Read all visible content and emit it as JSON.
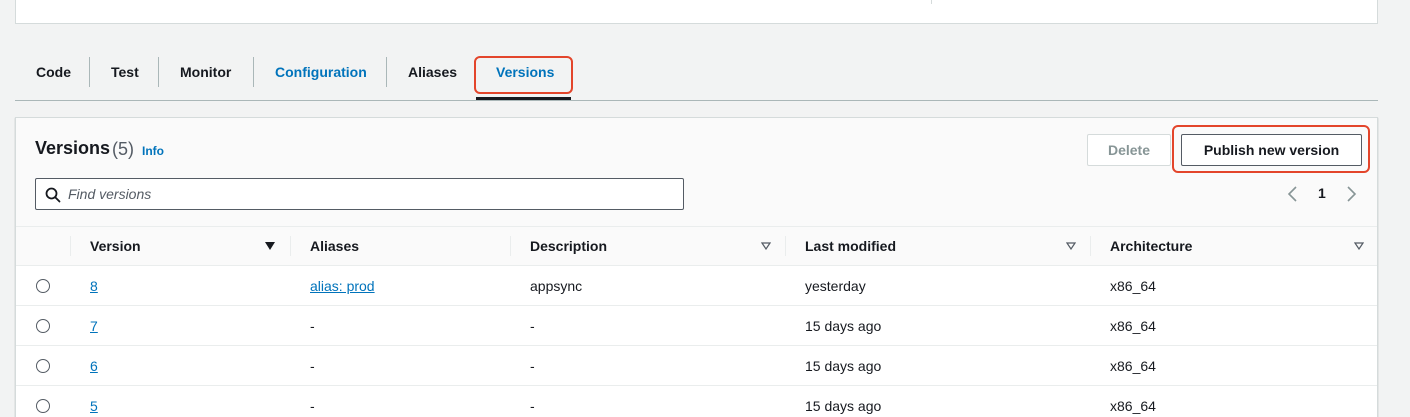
{
  "tabs": [
    {
      "label": "Code"
    },
    {
      "label": "Test"
    },
    {
      "label": "Monitor"
    },
    {
      "label": "Configuration"
    },
    {
      "label": "Aliases"
    },
    {
      "label": "Versions"
    }
  ],
  "active_tab": "Versions",
  "panel": {
    "title": "Versions",
    "count": "(5)",
    "info_label": "Info",
    "delete_label": "Delete",
    "publish_label": "Publish new version"
  },
  "search": {
    "placeholder": "Find versions",
    "value": ""
  },
  "pagination": {
    "current_page": "1"
  },
  "table": {
    "columns": [
      "Version",
      "Aliases",
      "Description",
      "Last modified",
      "Architecture"
    ],
    "rows": [
      {
        "version": "8",
        "aliases": "alias: prod",
        "description": "appsync",
        "last_modified": "yesterday",
        "architecture": "x86_64"
      },
      {
        "version": "7",
        "aliases": "-",
        "description": "-",
        "last_modified": "15 days ago",
        "architecture": "x86_64"
      },
      {
        "version": "6",
        "aliases": "-",
        "description": "-",
        "last_modified": "15 days ago",
        "architecture": "x86_64"
      },
      {
        "version": "5",
        "aliases": "-",
        "description": "-",
        "last_modified": "15 days ago",
        "architecture": "x86_64"
      }
    ]
  },
  "colors": {
    "link": "#0073bb",
    "highlight": "#e3452b",
    "text": "#16191f"
  },
  "icons": {
    "search": "search-icon",
    "sort": "caret-down-icon",
    "prev": "chevron-left-icon",
    "next": "chevron-right-icon"
  }
}
